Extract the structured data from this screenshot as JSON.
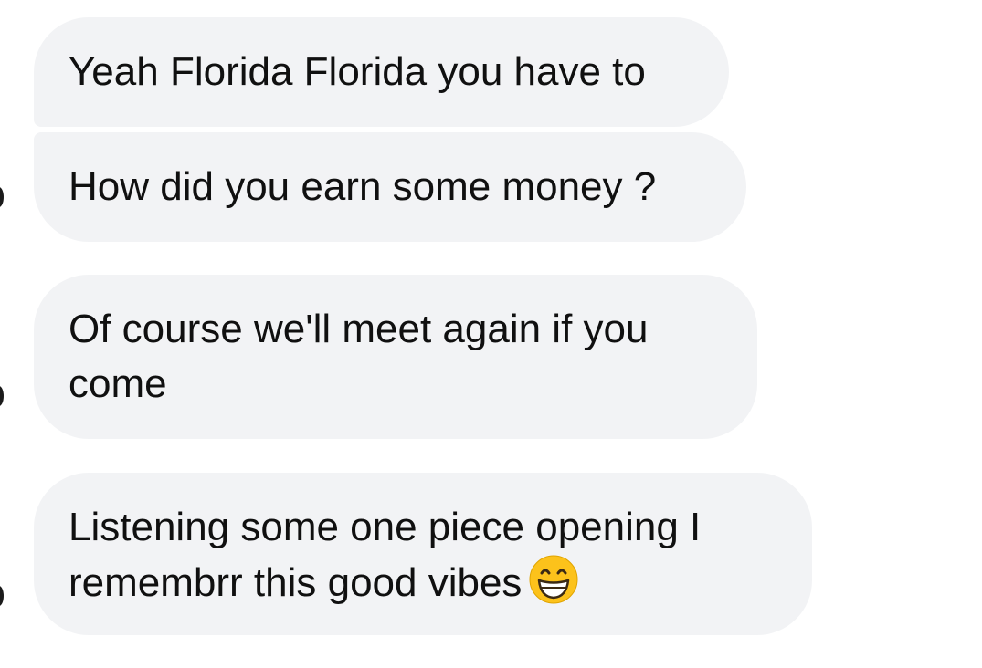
{
  "messages": [
    {
      "text": "Yeah Florida Florida you have to"
    },
    {
      "text": "How did you earn some money ?"
    },
    {
      "lines": [
        "Of course we'll meet again if you",
        "come"
      ]
    },
    {
      "lines": [
        "Listening some one piece opening I",
        "remembrr this good vibes"
      ],
      "emoji": "grinning-face-with-smiling-eyes-icon"
    }
  ],
  "colors": {
    "bubble_bg": "#f2f3f5",
    "text": "#101010",
    "emoji_face": "#fcc21b"
  }
}
